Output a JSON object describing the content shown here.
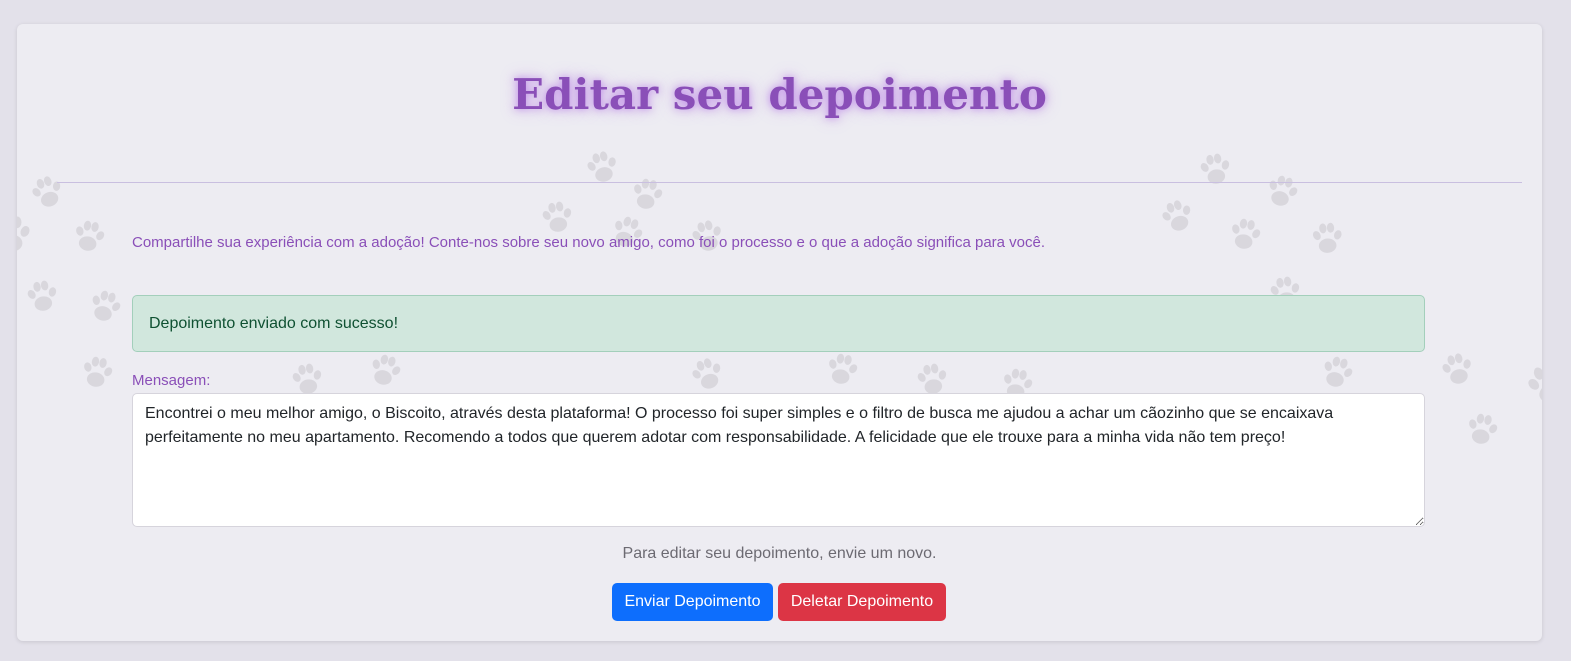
{
  "page": {
    "title": "Editar seu depoimento",
    "intro": "Compartilhe sua experiência com a adoção! Conte-nos sobre seu novo amigo, como foi o processo e o que a adoção significa para você."
  },
  "alert": {
    "message": "Depoimento enviado com sucesso!",
    "status": "success"
  },
  "form": {
    "message_label": "Mensagem:",
    "message_value": "Encontrei o meu melhor amigo, o Biscoito, através desta plataforma! O processo foi super simples e o filtro de busca me ajudou a achar um cãozinho que se encaixava perfeitamente no meu apartamento. Recomendo a todos que querem adotar com responsabilidade. A felicidade que ele trouxe para a minha vida não tem preço!",
    "hint": "Para editar seu depoimento, envie um novo.",
    "send_button": "Enviar Depoimento",
    "delete_button": "Deletar Depoimento"
  },
  "colors": {
    "accent": "#8a4fb8",
    "success_bg": "#d1e7dd",
    "success_text": "#0f5132",
    "primary": "#0d6efd",
    "danger": "#dc3545"
  },
  "decoration": {
    "background_icon": "paw-print-icon"
  }
}
